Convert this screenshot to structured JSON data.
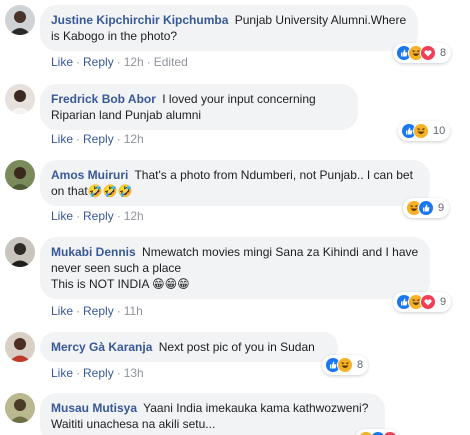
{
  "actions": {
    "like": "Like",
    "reply": "Reply",
    "sep": "·"
  },
  "comments": [
    {
      "author": "Justine Kipchirchir Kipchumba",
      "text": "Punjab University Alumni.Where is Kabogo in the photo?",
      "time": "12h",
      "edited": "Edited",
      "reactions": {
        "icons": [
          "like-icon",
          "haha-icon",
          "love-icon"
        ],
        "count": "8"
      },
      "avatar_color": "#4a4a4a"
    },
    {
      "author": "Fredrick Bob Abor",
      "text": "I loved your input concerning Riparian land Punjab alumni",
      "time": "12h",
      "reactions": {
        "icons": [
          "like-icon",
          "haha-icon"
        ],
        "count": "10"
      },
      "avatar_color": "#7d6a58"
    },
    {
      "author": "Amos Muiruri",
      "text": "That's a photo from Ndumberi, not Punjab.. I can bet on that",
      "emoji": "🤣🤣🤣",
      "time": "12h",
      "reactions": {
        "icons": [
          "haha-icon",
          "like-icon"
        ],
        "count": "9"
      },
      "avatar_color": "#5e6b4a"
    },
    {
      "author": "Mukabi Dennis",
      "text": "Nmewatch movies mingi Sana za Kihindi and I have never seen such a place",
      "text2": "This is NOT INDIA",
      "emoji": "😁😁😁",
      "time": "11h",
      "reactions": {
        "icons": [
          "like-icon",
          "haha-icon",
          "love-icon"
        ],
        "count": "9"
      },
      "avatar_color": "#2d2a28"
    },
    {
      "author": "Mercy Gà Karanja",
      "text": "Next post pic of you in Sudan",
      "time": "13h",
      "reactions": {
        "icons": [
          "like-icon",
          "haha-icon"
        ],
        "count": "8"
      },
      "avatar_color": "#c0392b"
    },
    {
      "author": "Musau Mutisya",
      "text": "Yaani India imekauka kama kathwozweni? Waititi unachesa na akili setu...",
      "avatar_color": "#8a8f5c"
    }
  ],
  "colors": {
    "link": "#385898",
    "bubble": "#f2f3f5",
    "like": "#1877f2",
    "haha": "#f7b125",
    "love": "#f33e58"
  }
}
